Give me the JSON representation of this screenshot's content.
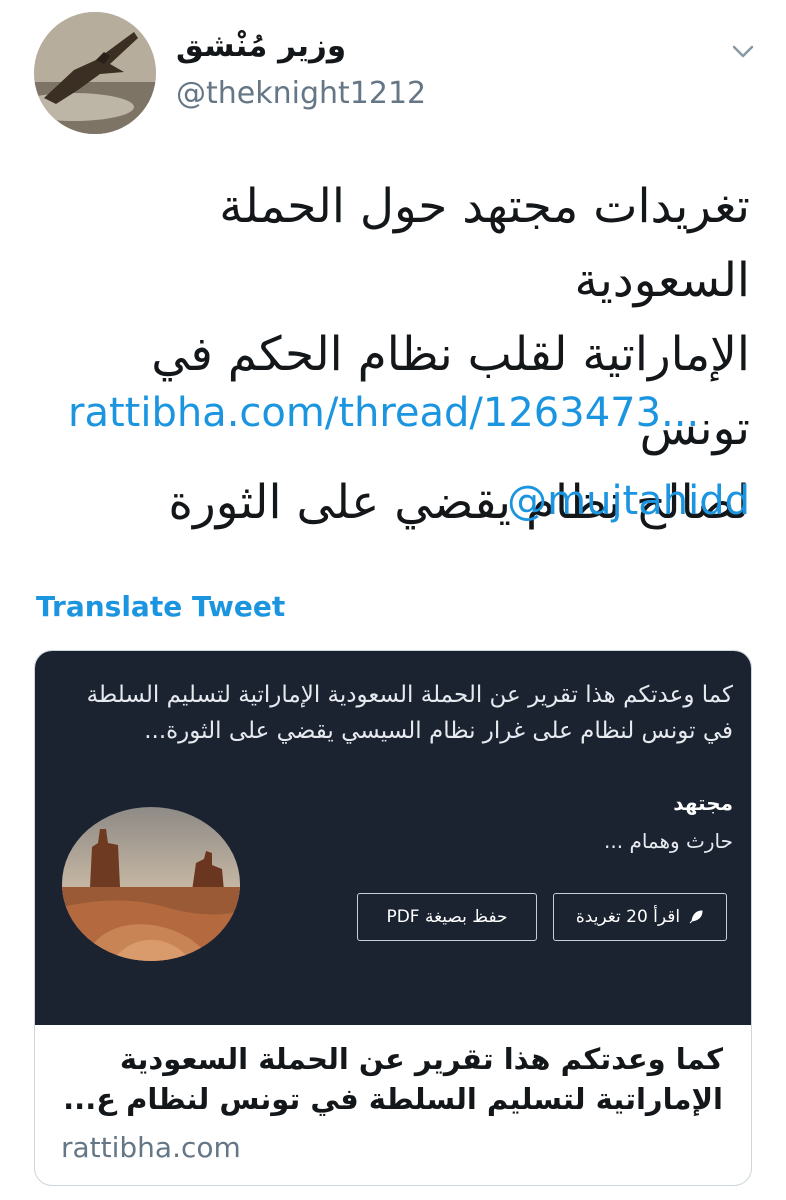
{
  "tweet": {
    "display_name": "وزير مُنْشق",
    "handle": "@theknight1212",
    "text_lines": [
      "تغريدات مجتهد حول الحملة السعودية",
      "الإماراتية لقلب نظام الحكم في تونس",
      "لصالح نظام يقضي على الثورة"
    ],
    "link": "rattibha.com/thread/1263473...",
    "mention": "@mujtahidd",
    "translate_label": "Translate Tweet"
  },
  "card": {
    "quote_lines": [
      "كما وعدتكم هذا تقرير عن الحملة السعودية الإماراتية لتسليم السلطة",
      "في تونس لنظام على غرار نظام السيسي يقضي على الثورة..."
    ],
    "author": "مجتهد",
    "author_sub": "حارث وهمام ...",
    "read_button": "اقرأ 20 تغريدة",
    "pdf_button": "حفظ بصيغة PDF",
    "title_lines": [
      "كما وعدتكم هذا تقرير عن الحملة السعودية",
      "الإماراتية لتسليم السلطة في تونس لنظام ع..."
    ],
    "domain": "rattibha.com"
  },
  "colors": {
    "link": "#1b95e0",
    "card_media_bg": "#1b2331",
    "secondary_text": "#657786"
  },
  "icons": {
    "menu": "chevron-down-icon",
    "read": "feather-icon"
  }
}
